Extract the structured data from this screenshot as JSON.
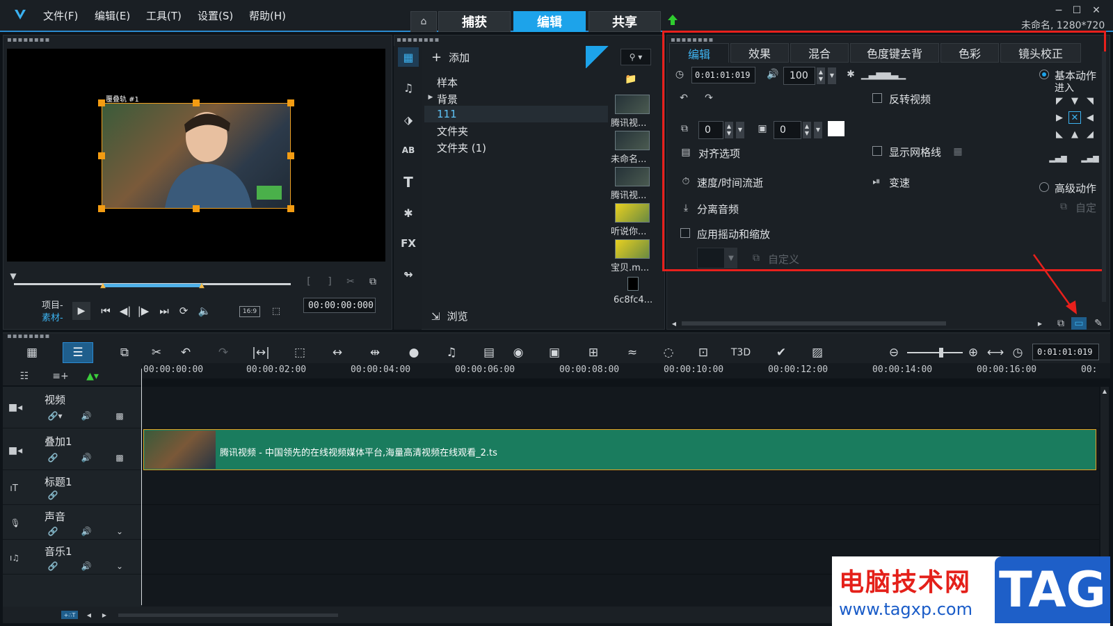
{
  "menu": [
    "文件(F)",
    "编辑(E)",
    "工具(T)",
    "设置(S)",
    "帮助(H)"
  ],
  "main_tabs": [
    "捕获",
    "编辑",
    "共享"
  ],
  "window": {
    "project_info": "未命名, 1280*720"
  },
  "preview": {
    "clip_label": "覆叠轨 #1",
    "mode_project": "项目-",
    "mode_clip": "素材-",
    "timecode": "00:00:00:000",
    "aspect": "16:9"
  },
  "library": {
    "add_label": "添加",
    "folders": [
      "样本",
      "背景",
      "111",
      "文件夹",
      "文件夹 (1)"
    ],
    "browse_label": "浏览",
    "thumbs": [
      "腾讯视...",
      "未命名...",
      "腾讯视...",
      "听说你...",
      "宝贝.m...",
      "6c8fc4..."
    ],
    "side_icons": [
      "media-icon",
      "instant-project-icon",
      "transition-icon",
      "title-icon",
      "text-icon",
      "graphics-icon",
      "fx-icon",
      "path-icon"
    ]
  },
  "options": {
    "tabs": [
      "编辑",
      "效果",
      "混合",
      "色度键去背",
      "色彩",
      "镜头校正"
    ],
    "duration": "0:01:01:019",
    "volume": "100",
    "reverse_video": "反转视频",
    "rotate_value": "0",
    "border_value": "0",
    "align_options": "对齐选项",
    "show_grid": "显示网格线",
    "speed_time": "速度/时间流逝",
    "variable_speed": "变速",
    "split_audio": "分离音频",
    "pan_zoom": "应用摇动和缩放",
    "customize": "自定义",
    "basic_motion": "基本动作",
    "enter": "进入",
    "advanced_motion": "高级动作",
    "custom": "自定"
  },
  "timeline": {
    "timecode": "0:01:01:019",
    "ruler": [
      "00:00:00:00",
      "00:00:02:00",
      "00:00:04:00",
      "00:00:06:00",
      "00:00:08:00",
      "00:00:10:00",
      "00:00:12:00",
      "00:00:14:00",
      "00:00:16:00",
      "00:"
    ],
    "tracks": [
      "视频",
      "叠加1",
      "标题1",
      "声音",
      "音乐1"
    ],
    "clip_title": "腾讯视频 - 中国领先的在线视频媒体平台,海量高清视频在线观看_2.ts"
  },
  "watermark": {
    "cn": "电脑技术网",
    "url": "www.tagxp.com",
    "tag": "TAG"
  }
}
